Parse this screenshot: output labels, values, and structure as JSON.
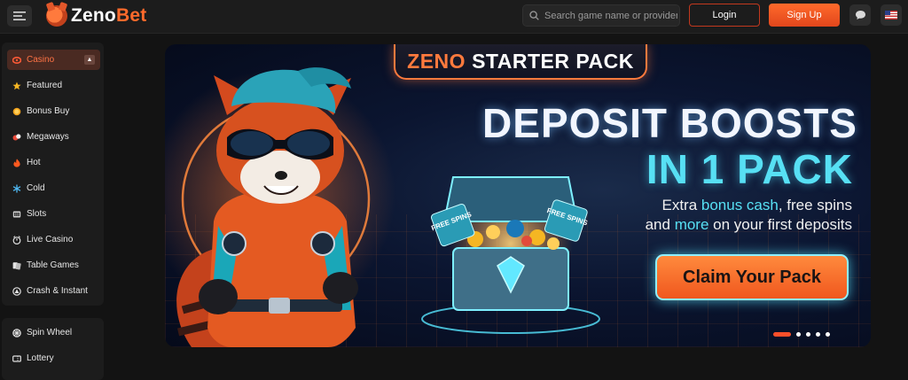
{
  "header": {
    "logo": {
      "part1": "Zeno",
      "part2": "Bet"
    },
    "search_placeholder": "Search game name or provider...",
    "login_label": "Login",
    "signup_label": "Sign Up",
    "icons": [
      "menu-icon",
      "search-icon",
      "chat-icon",
      "us-flag-icon"
    ]
  },
  "sidebar": {
    "section": {
      "label": "Casino",
      "icon": "casino-icon",
      "expanded": true
    },
    "items": [
      {
        "label": "Featured",
        "icon": "star-icon"
      },
      {
        "label": "Bonus Buy",
        "icon": "coin-icon"
      },
      {
        "label": "Megaways",
        "icon": "megaways-icon"
      },
      {
        "label": "Hot",
        "icon": "flame-icon"
      },
      {
        "label": "Cold",
        "icon": "snowflake-icon"
      },
      {
        "label": "Slots",
        "icon": "slots-icon"
      },
      {
        "label": "Live Casino",
        "icon": "live-icon"
      },
      {
        "label": "Table Games",
        "icon": "cards-icon"
      },
      {
        "label": "Crash & Instant",
        "icon": "crash-icon"
      }
    ],
    "extras": [
      {
        "label": "Spin Wheel",
        "icon": "wheel-icon"
      },
      {
        "label": "Lottery",
        "icon": "lottery-icon"
      }
    ]
  },
  "banner": {
    "tag_word1": "ZENO",
    "tag_word2": "STARTER PACK",
    "headline1": "DEPOSIT BOOSTS",
    "headline2": "IN 1 PACK",
    "sub": {
      "t1": "Extra ",
      "h1": "bonus cash",
      "t2": ", free spins",
      "t3": "and ",
      "h2": "more",
      "t4": " on your first deposits"
    },
    "chest_text_left": "FREE SPINS",
    "chest_text_right": "FREE SPINS",
    "cta_label": "Claim Your Pack",
    "slides_total": 5,
    "active_slide": 1
  },
  "colors": {
    "accent": "#ff6a2b",
    "cyan": "#57e0f4",
    "sidebar_bg": "#1c1c1c",
    "page_bg": "#131313"
  }
}
